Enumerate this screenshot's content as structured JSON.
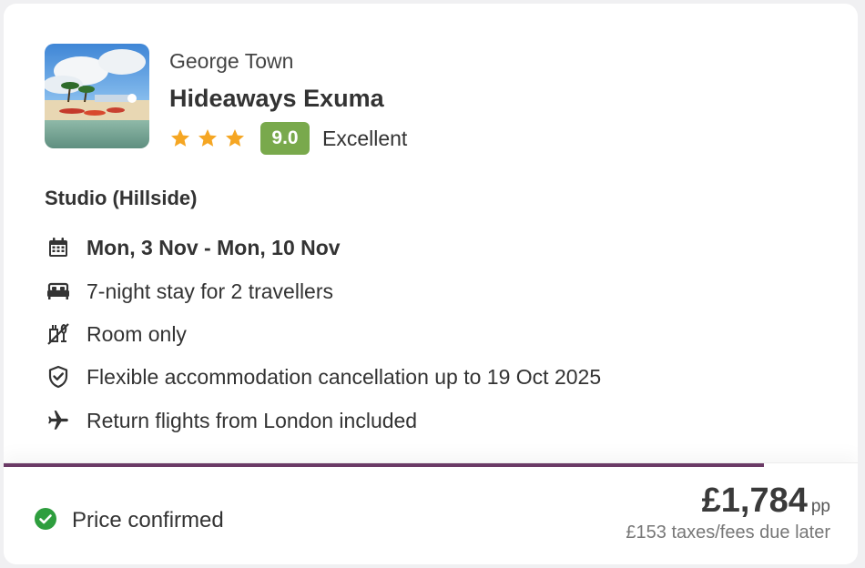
{
  "hotel": {
    "location": "George Town",
    "name": "Hideaways Exuma",
    "star_count": 3,
    "score": "9.0",
    "score_label": "Excellent",
    "image": "beach-resort-thumbnail"
  },
  "room": {
    "type": "Studio (Hillside)"
  },
  "details": [
    {
      "icon": "calendar-icon",
      "text": "Mon, 3 Nov - Mon, 10 Nov",
      "bold": true
    },
    {
      "icon": "bed-icon",
      "text": "7-night stay  for 2 travellers",
      "bold": false
    },
    {
      "icon": "no-meals-icon",
      "text": "Room only",
      "bold": false
    },
    {
      "icon": "shield-check-icon",
      "text": "Flexible accommodation cancellation up to 19 Oct 2025",
      "bold": false
    },
    {
      "icon": "airplane-icon",
      "text": "Return flights from London included",
      "bold": false
    }
  ],
  "footer": {
    "status": "Price confirmed",
    "price": "£1,784",
    "price_unit": "pp",
    "taxes_note": "£153 taxes/fees due later",
    "progress": 0.89
  },
  "colors": {
    "score_badge": "#79a94c",
    "star": "#f5a623",
    "progress": "#6b3a66",
    "confirmed_check": "#2e9e3e"
  }
}
